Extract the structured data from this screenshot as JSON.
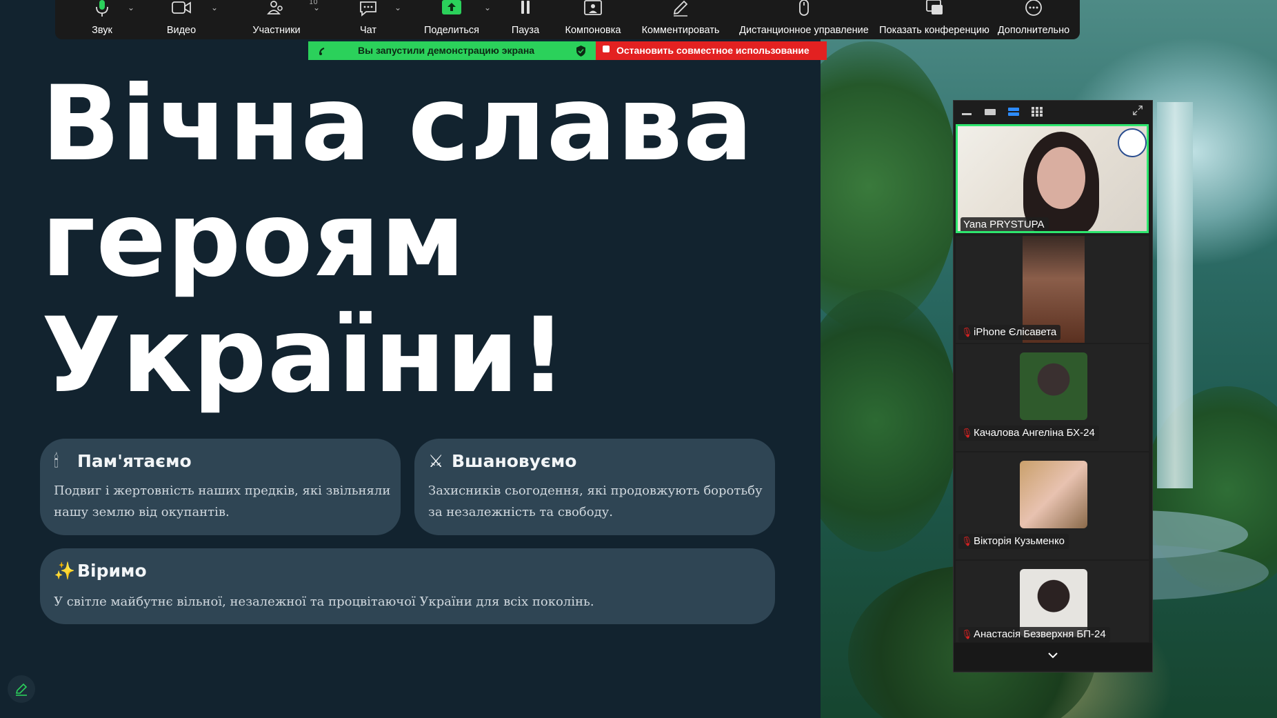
{
  "toolbar": {
    "items": [
      {
        "label": "Звук",
        "icon": "microphone-icon"
      },
      {
        "label": "Видео",
        "icon": "video-camera-icon"
      },
      {
        "label": "Участники",
        "icon": "participants-icon",
        "badge": "10"
      },
      {
        "label": "Чат",
        "icon": "chat-icon"
      },
      {
        "label": "Поделиться",
        "icon": "share-screen-icon"
      },
      {
        "label": "Пауза",
        "icon": "pause-icon"
      },
      {
        "label": "Компоновка",
        "icon": "layout-icon"
      },
      {
        "label": "Комментировать",
        "icon": "annotate-pen-icon"
      },
      {
        "label": "Дистанционное управление",
        "icon": "mouse-icon"
      },
      {
        "label": "Показать конференцию",
        "icon": "show-meeting-icon"
      },
      {
        "label": "Дополнительно",
        "icon": "more-icon"
      }
    ]
  },
  "share_banner": {
    "text": "Вы запустили демонстрацию экрана",
    "stop_label": "Остановить совместное использование",
    "colors": {
      "banner": "#2bd15b",
      "stop": "#e32121"
    }
  },
  "slide": {
    "title_lines": [
      "Вічна слава",
      "героям",
      "України!"
    ],
    "cards": [
      {
        "emoji": "🕯",
        "title": "Пам'ятаємо",
        "body": "Подвиг і жертовність наших предків, які звільняли нашу землю від окупантів."
      },
      {
        "emoji": "⚔",
        "title": "Вшановуємо",
        "body": "Захисників сьогодення, які продовжують боротьбу за незалежність та свободу."
      },
      {
        "emoji": "✨",
        "title": "Віримо",
        "body": "У світле майбутнє вільної, незалежної та процвітаючої України для всіх поколінь."
      }
    ]
  },
  "participants": [
    {
      "name": "Yana PRYSTUPA",
      "active": true,
      "muted": false
    },
    {
      "name": "iPhone Єлісавета",
      "muted": true
    },
    {
      "name": "Качалова Ангеліна БХ-24",
      "muted": true
    },
    {
      "name": "Вікторія Кузьменко",
      "muted": true
    },
    {
      "name": "Анастасія Безверхня БП-24",
      "muted": true
    }
  ]
}
